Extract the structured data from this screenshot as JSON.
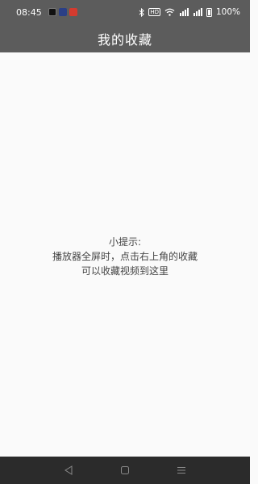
{
  "status_bar": {
    "time": "08:45",
    "hd_label": "HD",
    "battery_percent": "100%",
    "signal_label_1": "4G",
    "signal_label_2": "4G"
  },
  "title_bar": {
    "title": "我的收藏"
  },
  "tip": {
    "line1": "小提示:",
    "line2": "播放器全屏时，点击右上角的收藏",
    "line3": "可以收藏视频到这里"
  },
  "nav_bar": {
    "back_icon": "back-triangle",
    "home_icon": "home-square",
    "menu_icon": "menu-lines"
  },
  "colors": {
    "bar": "#5c5c5c",
    "content_bg": "#fafafa",
    "nav_bar": "#2b2b2b"
  }
}
